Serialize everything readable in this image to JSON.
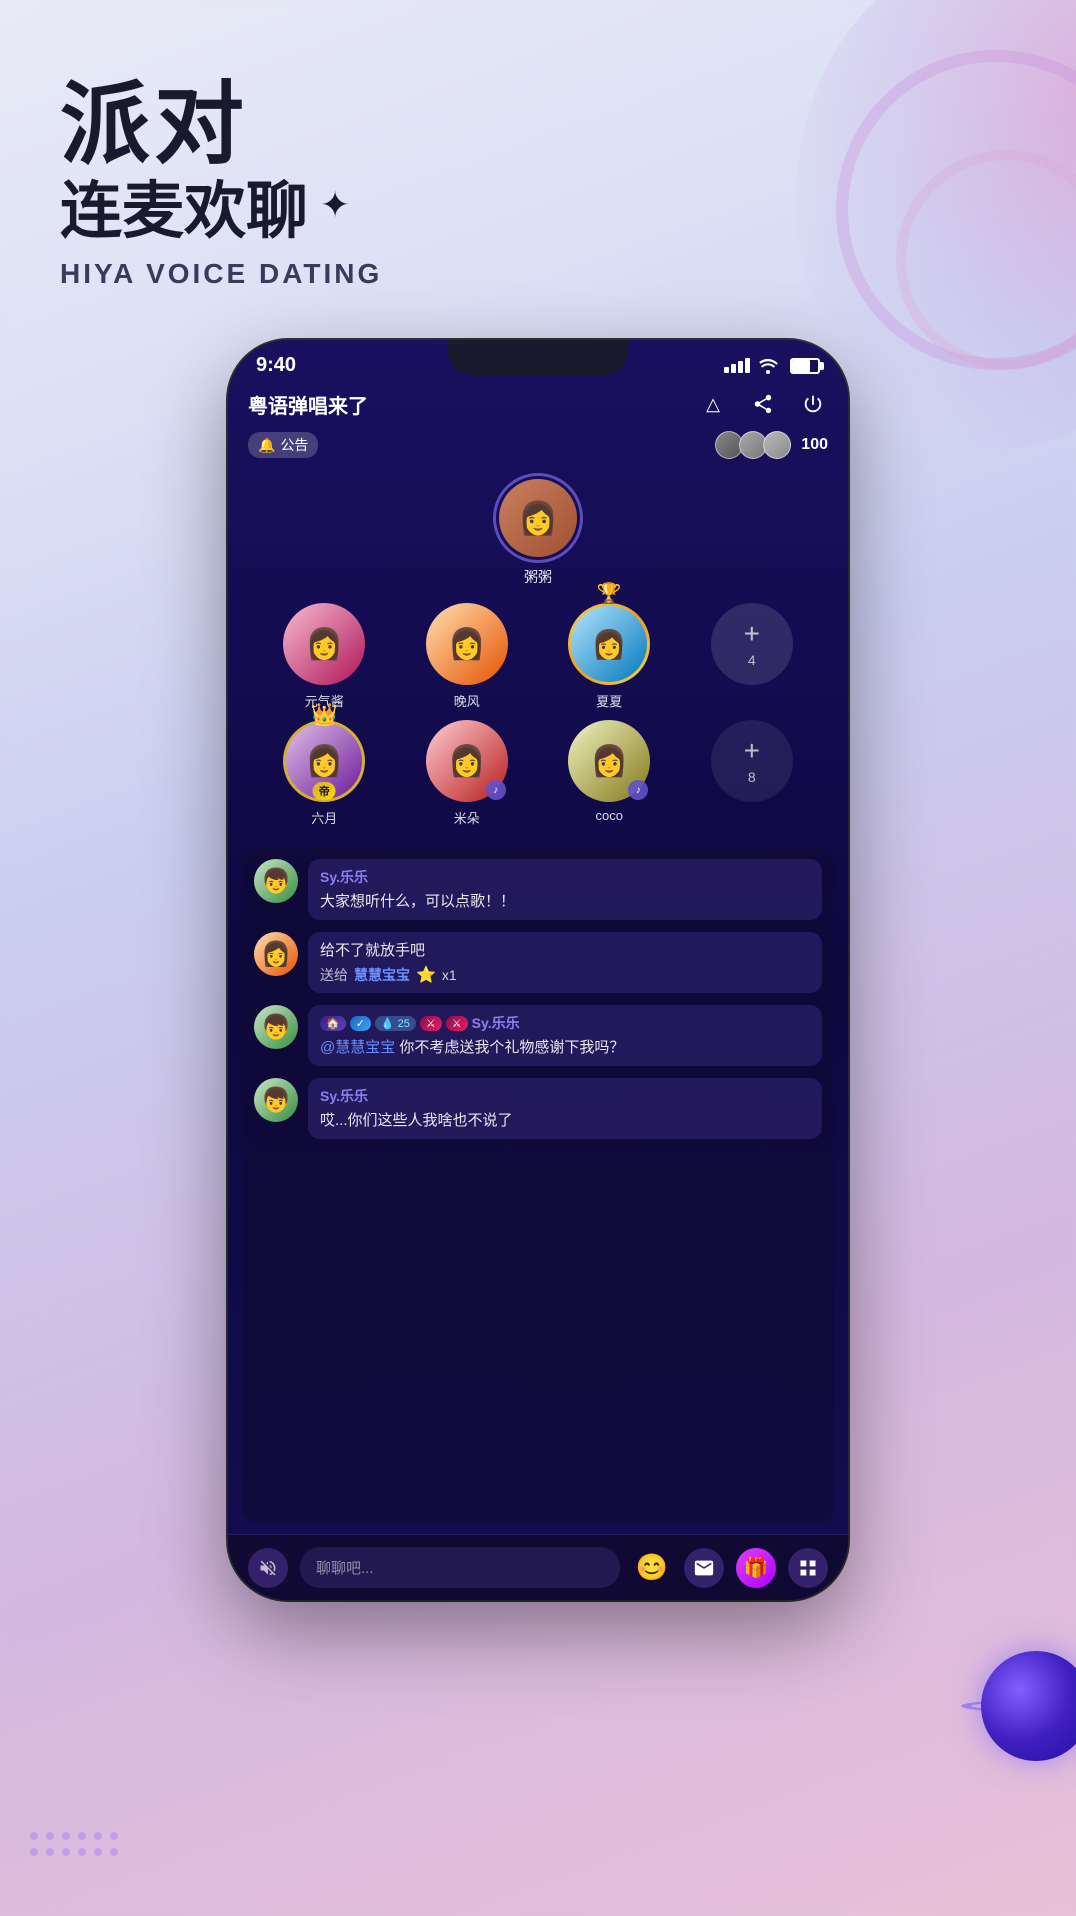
{
  "header": {
    "main_text": "派对",
    "sub_text": "连麦欢聊",
    "english_text": "HIYA VOICE DATING",
    "sparkle": "✦"
  },
  "phone": {
    "status_bar": {
      "time": "9:40",
      "signal": "▪▪▪▪",
      "wifi": "WiFi",
      "battery": "Battery"
    },
    "room": {
      "title": "粤语弹唱来了",
      "announcement": "公告",
      "viewer_count": "100",
      "action_report": "△",
      "action_share": "⤴",
      "action_power": "⏻"
    },
    "stage": {
      "host": {
        "label": "粥粥",
        "avatar_emoji": "👩"
      },
      "slots": [
        {
          "label": "元气酱",
          "type": "person",
          "class": "person-1"
        },
        {
          "label": "晚风",
          "type": "person",
          "class": "person-2"
        },
        {
          "label": "夏夏",
          "type": "featured",
          "class": "person-3"
        },
        {
          "label": "4",
          "type": "add"
        },
        {
          "label": "六月",
          "type": "crowned",
          "class": "person-5"
        },
        {
          "label": "米朵",
          "type": "music",
          "class": "person-6"
        },
        {
          "label": "coco",
          "type": "music2",
          "class": "person-7"
        },
        {
          "label": "8",
          "type": "add2"
        }
      ]
    },
    "chat": {
      "messages": [
        {
          "username": "Sy.乐乐",
          "text": "大家想听什么，可以点歌！！",
          "avatar_class": "person-4"
        },
        {
          "username": "",
          "text": "给不了就放手吧",
          "gift_to": "慧慧宝宝",
          "gift_icon": "⭐",
          "gift_count": "x1",
          "avatar_class": "person-2",
          "is_gift": true
        },
        {
          "username": "Sy.乐乐",
          "text": "@慧慧宝宝 你不考虑送我个礼物感谢下我吗？",
          "avatar_class": "person-4",
          "has_badges": true,
          "badge_num": "25"
        },
        {
          "username": "Sy.乐乐",
          "text": "哎...你们这些人我啥也不说了",
          "avatar_class": "person-4"
        }
      ]
    },
    "bottom_nav": {
      "mute": "🔇",
      "chat_placeholder": "聊聊吧...",
      "emoji": "😊",
      "envelope": "✉",
      "gift": "🎁",
      "grid": "⊞"
    }
  }
}
